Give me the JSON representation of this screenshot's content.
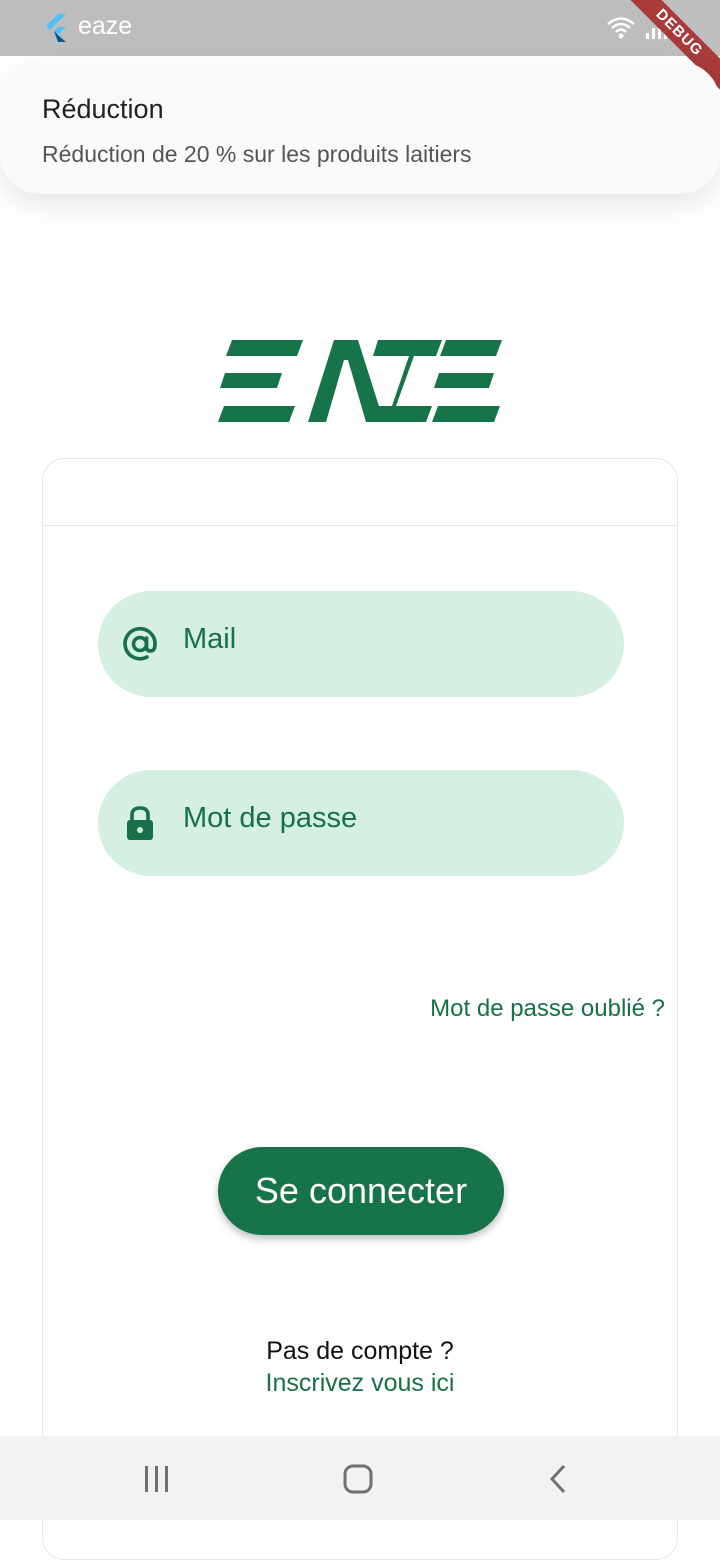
{
  "status_bar": {
    "app_name": "eaze",
    "debug_label": "DEBUG"
  },
  "notification": {
    "title": "Réduction",
    "body": "Réduction de 20 % sur les produits laitiers"
  },
  "login": {
    "email_placeholder": "Mail",
    "password_placeholder": "Mot de passe",
    "forgot_password": "Mot de passe oublié ?",
    "submit": "Se connecter",
    "no_account": "Pas de compte ?",
    "signup_link": "Inscrivez vous ici"
  },
  "icons": {
    "email": "at-icon",
    "password": "lock-icon"
  },
  "colors": {
    "brand_green": "#17744a",
    "field_background": "#d5efe2",
    "status_bar": "#bdbdbd"
  }
}
